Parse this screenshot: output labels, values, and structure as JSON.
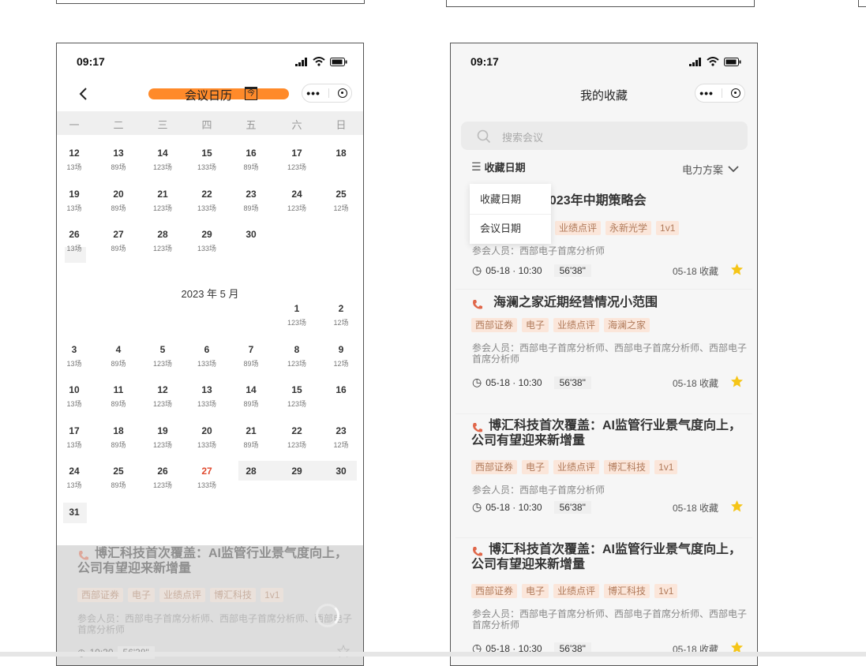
{
  "left_phone": {
    "status_time": "09:17",
    "nav_title": "会议日历",
    "calendar_icon_text": "今",
    "weekdays": [
      "一",
      "二",
      "三",
      "四",
      "五",
      "六",
      "日"
    ],
    "april_rows": [
      [
        {
          "d": "12",
          "n": "13场"
        },
        {
          "d": "13",
          "n": "89场"
        },
        {
          "d": "14",
          "n": "123场"
        },
        {
          "d": "15",
          "n": "133场"
        },
        {
          "d": "16",
          "n": "89场"
        },
        {
          "d": "17",
          "n": "123场"
        },
        {
          "d": "18",
          "n": ""
        }
      ],
      [
        {
          "d": "19",
          "n": "13场"
        },
        {
          "d": "20",
          "n": "89场"
        },
        {
          "d": "21",
          "n": "123场"
        },
        {
          "d": "22",
          "n": "133场"
        },
        {
          "d": "23",
          "n": "89场"
        },
        {
          "d": "24",
          "n": "123场"
        },
        {
          "d": "25",
          "n": "12场"
        }
      ],
      [
        {
          "d": "26",
          "n": "13场"
        },
        {
          "d": "27",
          "n": "89场"
        },
        {
          "d": "28",
          "n": "123场"
        },
        {
          "d": "29",
          "n": "133场"
        },
        {
          "d": "30",
          "n": ""
        }
      ]
    ],
    "month_title": "2023 年 5 月",
    "may_rows": [
      [
        {
          "col": 5,
          "d": "1",
          "n": "123场"
        },
        {
          "col": 6,
          "d": "2",
          "n": "12场"
        }
      ],
      [
        {
          "col": 0,
          "d": "3",
          "n": "13场"
        },
        {
          "col": 1,
          "d": "4",
          "n": "89场"
        },
        {
          "col": 2,
          "d": "5",
          "n": "123场"
        },
        {
          "col": 3,
          "d": "6",
          "n": "133场"
        },
        {
          "col": 4,
          "d": "7",
          "n": "89场"
        },
        {
          "col": 5,
          "d": "8",
          "n": "123场"
        },
        {
          "col": 6,
          "d": "9",
          "n": "12场"
        }
      ],
      [
        {
          "col": 0,
          "d": "10",
          "n": "13场"
        },
        {
          "col": 1,
          "d": "11",
          "n": "89场"
        },
        {
          "col": 2,
          "d": "12",
          "n": "123场"
        },
        {
          "col": 3,
          "d": "13",
          "n": "133场"
        },
        {
          "col": 4,
          "d": "14",
          "n": "89场"
        },
        {
          "col": 5,
          "d": "15",
          "n": "123场"
        },
        {
          "col": 6,
          "d": "16",
          "n": ""
        }
      ],
      [
        {
          "col": 0,
          "d": "17",
          "n": "13场"
        },
        {
          "col": 1,
          "d": "18",
          "n": "89场"
        },
        {
          "col": 2,
          "d": "19",
          "n": "123场"
        },
        {
          "col": 3,
          "d": "20",
          "n": "133场"
        },
        {
          "col": 4,
          "d": "21",
          "n": "89场"
        },
        {
          "col": 5,
          "d": "22",
          "n": "123场"
        },
        {
          "col": 6,
          "d": "23",
          "n": "12场"
        }
      ],
      [
        {
          "col": 0,
          "d": "24",
          "n": "13场"
        },
        {
          "col": 1,
          "d": "25",
          "n": "89场"
        },
        {
          "col": 2,
          "d": "26",
          "n": "123场"
        },
        {
          "col": 3,
          "d": "27",
          "n": "133场",
          "today": true
        },
        {
          "col": 4,
          "d": "28",
          "n": ""
        },
        {
          "col": 5,
          "d": "29",
          "n": ""
        },
        {
          "col": 6,
          "d": "30",
          "n": ""
        }
      ],
      [
        {
          "col": 0,
          "d": "31",
          "n": ""
        }
      ]
    ],
    "overlay_card": {
      "title_line1": "博汇科技首次覆盖：AI监管行业景气度向上，",
      "title_line2": "公司有望迎来新增量",
      "tags": [
        "西部证券",
        "电子",
        "业绩点评",
        "博汇科技",
        "1v1"
      ],
      "attendees": "参会人员：西部电子首席分析师、西部电子首席分析师、西部电子首席分析师",
      "time": "10:30",
      "duration": "56'38\""
    }
  },
  "right_phone": {
    "status_time": "09:17",
    "nav_title": "我的收藏",
    "search_placeholder": "搜索会议",
    "sort_label": "收藏日期",
    "filter_label": "电力方案",
    "dropdown_options": [
      "收藏日期",
      "会议日期"
    ],
    "cards": [
      {
        "title_line1": "2023年中期策略会",
        "title_line2": "",
        "tags": [
          "业绩点评",
          "永新光学",
          "1v1"
        ],
        "attendees_line1": "参会人员：西部电子首席分析师",
        "attendees_line2": "",
        "time": "05-18 · 10:30",
        "duration": "56'38\"",
        "fav_date": "05-18 收藏"
      },
      {
        "title_line1": "海澜之家近期经营情况小范围",
        "title_line2": "",
        "tags": [
          "西部证券",
          "电子",
          "业绩点评",
          "海澜之家"
        ],
        "attendees_line1": "参会人员：西部电子首席分析师、西部电子首席分析师、西部电子",
        "attendees_line2": "首席分析师",
        "time": "05-18 · 10:30",
        "duration": "56'38\"",
        "fav_date": "05-18 收藏"
      },
      {
        "title_line1": "博汇科技首次覆盖：AI监管行业景气度向上，",
        "title_line2": "公司有望迎来新增量",
        "tags": [
          "西部证券",
          "电子",
          "业绩点评",
          "博汇科技",
          "1v1"
        ],
        "attendees_line1": "参会人员：西部电子首席分析师",
        "attendees_line2": "",
        "time": "05-18 · 10:30",
        "duration": "56'38\"",
        "fav_date": "05-18 收藏"
      },
      {
        "title_line1": "博汇科技首次覆盖：AI监管行业景气度向上，",
        "title_line2": "公司有望迎来新增量",
        "tags": [
          "西部证券",
          "电子",
          "业绩点评",
          "博汇科技",
          "1v1"
        ],
        "attendees_line1": "参会人员：西部电子首席分析师、西部电子首席分析师、西部电子",
        "attendees_line2": "首席分析师",
        "time": "05-18 · 10:30",
        "duration": "56'38\"",
        "fav_date": "05-18 收藏"
      }
    ]
  },
  "colors": {
    "accent_orange": "#ff8a2a",
    "star": "#f5c518",
    "tag_bg": "#fbe6da",
    "tag_text": "#b07a5a",
    "today": "#e04a2f",
    "phone_icon": "#e0674a"
  }
}
